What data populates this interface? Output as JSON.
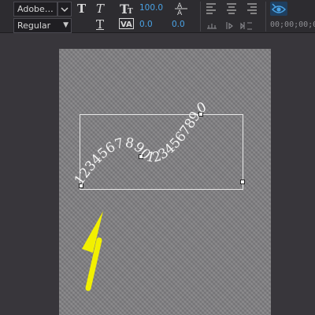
{
  "toolbar": {
    "font_family": "Adobe…",
    "font_style": "Regular",
    "size_value": "100.0",
    "leading_value": "0.0",
    "tracking_value": "0.0",
    "timecode": "00;00;00;00"
  },
  "canvas": {
    "path_text": "12345678901234567890"
  },
  "icons": {
    "bold": "bold-t-icon",
    "italic": "italic-t-icon",
    "underline": "underline-t-icon",
    "font_size": "font-size-icon",
    "kerning": "kerning-va-icon",
    "leading": "leading-icon",
    "align": "align-icons",
    "annotation": "yellow-arrow-icon"
  },
  "colors": {
    "accent": "#4aa3e6",
    "annotation": "#f2f000",
    "background": "#38363b"
  }
}
